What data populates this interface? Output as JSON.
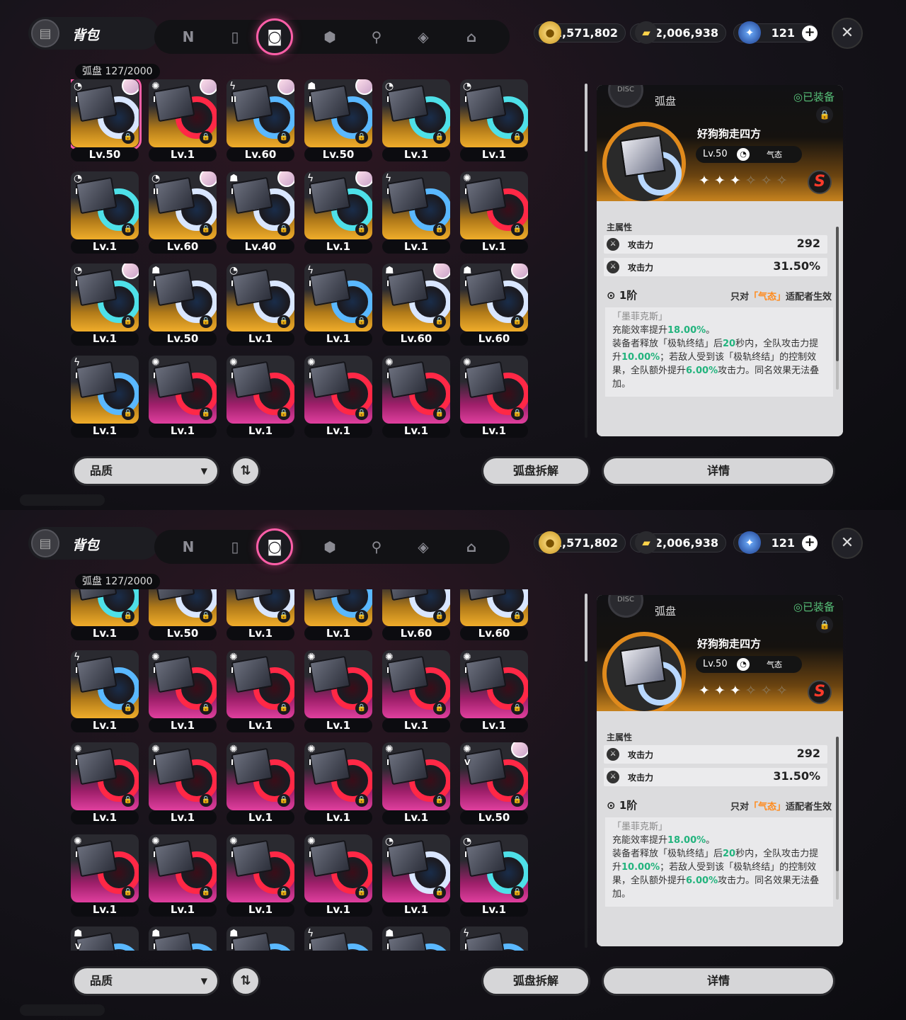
{
  "app": {
    "bag_title": "背包",
    "count_label": "弧盘 127/2000",
    "close": "✕",
    "nav": [
      {
        "icon": "tab-n-icon",
        "glyph": "N"
      },
      {
        "icon": "gameboy-icon",
        "glyph": "▯"
      },
      {
        "icon": "disc-tab-icon",
        "glyph": "◙",
        "active": true
      },
      {
        "icon": "box-icon",
        "glyph": "⬢"
      },
      {
        "icon": "food-icon",
        "glyph": "⚲"
      },
      {
        "icon": "cube-icon",
        "glyph": "◈"
      },
      {
        "icon": "home-icon",
        "glyph": "⌂"
      }
    ]
  },
  "currency": {
    "coins": "1,571,802",
    "tickets": "2,006,938",
    "gems": "121"
  },
  "buttons": {
    "quality": "品质",
    "dismantle": "弧盘拆解",
    "details": "详情",
    "sort": "⇅"
  },
  "detail": {
    "type": "弧盘",
    "equipped": "◎已装备",
    "name": "好狗狗走四方",
    "level": "Lv.50",
    "attr": "气态",
    "stars_on": 3,
    "stars_total": 6,
    "rank": "S",
    "main_stats_title": "主属性",
    "stats": [
      {
        "name": "攻击力",
        "value": "292"
      },
      {
        "name": "攻击力",
        "value": "31.50%"
      }
    ],
    "tier": "1阶",
    "tier_note_pre": "只对",
    "tier_note_q": "「气态」",
    "tier_note_post": "适配者生效",
    "passive_title": "「墨菲克斯」",
    "p1a": "充能效率提升",
    "p1b": "18.00%",
    "p1c": "。",
    "p2a": "装备者释放「极轨终结」后",
    "p2b": "20",
    "p2c": "秒内，全队攻击力提升",
    "p2d": "10.00%",
    "p2e": "；若敌人受到该「极轨终结」的控制效果，全队额外提升",
    "p2f": "6.00%",
    "p2g": "攻击力。同名效果无法叠加。"
  },
  "grid1": [
    {
      "lv": "Lv.50",
      "rank": "I",
      "bg": "gold",
      "ring": "white",
      "av": true,
      "sel": true,
      "at": "◔"
    },
    {
      "lv": "Lv.1",
      "rank": "I",
      "bg": "gold",
      "ring": "red",
      "av": true,
      "at": "✺"
    },
    {
      "lv": "Lv.60",
      "rank": "II",
      "bg": "gold",
      "ring": "blue",
      "av": true,
      "at": "ϟ"
    },
    {
      "lv": "Lv.50",
      "rank": "I",
      "bg": "gold",
      "ring": "blue",
      "av": true,
      "at": "☗"
    },
    {
      "lv": "Lv.1",
      "rank": "I",
      "bg": "gold",
      "ring": "teal",
      "av": false,
      "at": "◔"
    },
    {
      "lv": "Lv.1",
      "rank": "I",
      "bg": "gold",
      "ring": "teal",
      "av": false,
      "at": "◔"
    },
    {
      "lv": "Lv.1",
      "rank": "I",
      "bg": "gold",
      "ring": "teal",
      "av": false,
      "at": "◔"
    },
    {
      "lv": "Lv.60",
      "rank": "II",
      "bg": "gold",
      "ring": "white",
      "av": true,
      "at": "◔"
    },
    {
      "lv": "Lv.40",
      "rank": "I",
      "bg": "gold",
      "ring": "white",
      "av": true,
      "at": "☗"
    },
    {
      "lv": "Lv.1",
      "rank": "I",
      "bg": "gold",
      "ring": "teal",
      "av": true,
      "at": "ϟ"
    },
    {
      "lv": "Lv.1",
      "rank": "I",
      "bg": "gold",
      "ring": "blue",
      "av": false,
      "at": "ϟ"
    },
    {
      "lv": "Lv.1",
      "rank": "I",
      "bg": "gold",
      "ring": "red",
      "av": false,
      "at": "✺"
    },
    {
      "lv": "Lv.1",
      "rank": "I",
      "bg": "gold",
      "ring": "teal",
      "av": true,
      "at": "◔"
    },
    {
      "lv": "Lv.50",
      "rank": "I",
      "bg": "gold",
      "ring": "white",
      "av": false,
      "at": "☗"
    },
    {
      "lv": "Lv.1",
      "rank": "I",
      "bg": "gold",
      "ring": "white",
      "av": false,
      "at": "◔"
    },
    {
      "lv": "Lv.1",
      "rank": "I",
      "bg": "gold",
      "ring": "blue",
      "av": false,
      "at": "ϟ"
    },
    {
      "lv": "Lv.60",
      "rank": "I",
      "bg": "gold",
      "ring": "white",
      "av": true,
      "at": "☗"
    },
    {
      "lv": "Lv.60",
      "rank": "I",
      "bg": "gold",
      "ring": "white",
      "av": true,
      "at": "☗"
    },
    {
      "lv": "Lv.1",
      "rank": "I",
      "bg": "gold",
      "ring": "blue",
      "av": false,
      "at": "ϟ"
    },
    {
      "lv": "Lv.1",
      "rank": "I",
      "bg": "pink",
      "ring": "red",
      "av": false,
      "at": "✺"
    },
    {
      "lv": "Lv.1",
      "rank": "I",
      "bg": "pink",
      "ring": "red",
      "av": false,
      "at": "✺"
    },
    {
      "lv": "Lv.1",
      "rank": "I",
      "bg": "pink",
      "ring": "red",
      "av": false,
      "at": "✺"
    },
    {
      "lv": "Lv.1",
      "rank": "I",
      "bg": "pink",
      "ring": "red",
      "av": false,
      "at": "✺"
    },
    {
      "lv": "Lv.1",
      "rank": "I",
      "bg": "pink",
      "ring": "red",
      "av": false,
      "at": "✺"
    }
  ],
  "grid2": [
    {
      "lv": "Lv.1",
      "rank": "",
      "bg": "gold",
      "ring": "teal",
      "av": false,
      "at": ""
    },
    {
      "lv": "Lv.50",
      "rank": "",
      "bg": "gold",
      "ring": "white",
      "av": false,
      "at": ""
    },
    {
      "lv": "Lv.1",
      "rank": "",
      "bg": "gold",
      "ring": "white",
      "av": false,
      "at": ""
    },
    {
      "lv": "Lv.1",
      "rank": "",
      "bg": "gold",
      "ring": "blue",
      "av": false,
      "at": ""
    },
    {
      "lv": "Lv.60",
      "rank": "",
      "bg": "gold",
      "ring": "white",
      "av": false,
      "at": ""
    },
    {
      "lv": "Lv.60",
      "rank": "",
      "bg": "gold",
      "ring": "white",
      "av": false,
      "at": ""
    },
    {
      "lv": "Lv.1",
      "rank": "I",
      "bg": "gold",
      "ring": "blue",
      "av": false,
      "at": "ϟ"
    },
    {
      "lv": "Lv.1",
      "rank": "I",
      "bg": "pink",
      "ring": "red",
      "av": false,
      "at": "✺"
    },
    {
      "lv": "Lv.1",
      "rank": "I",
      "bg": "pink",
      "ring": "red",
      "av": false,
      "at": "✺"
    },
    {
      "lv": "Lv.1",
      "rank": "I",
      "bg": "pink",
      "ring": "red",
      "av": false,
      "at": "✺"
    },
    {
      "lv": "Lv.1",
      "rank": "I",
      "bg": "pink",
      "ring": "red",
      "av": false,
      "at": "✺"
    },
    {
      "lv": "Lv.1",
      "rank": "I",
      "bg": "pink",
      "ring": "red",
      "av": false,
      "at": "✺"
    },
    {
      "lv": "Lv.1",
      "rank": "I",
      "bg": "pink",
      "ring": "red",
      "av": false,
      "at": "✺"
    },
    {
      "lv": "Lv.1",
      "rank": "I",
      "bg": "pink",
      "ring": "red",
      "av": false,
      "at": "✺"
    },
    {
      "lv": "Lv.1",
      "rank": "I",
      "bg": "pink",
      "ring": "red",
      "av": false,
      "at": "✺"
    },
    {
      "lv": "Lv.1",
      "rank": "I",
      "bg": "pink",
      "ring": "red",
      "av": false,
      "at": "✺"
    },
    {
      "lv": "Lv.1",
      "rank": "I",
      "bg": "pink",
      "ring": "red",
      "av": false,
      "at": "✺"
    },
    {
      "lv": "Lv.50",
      "rank": "V",
      "bg": "pink",
      "ring": "red",
      "av": true,
      "at": "✺"
    },
    {
      "lv": "Lv.1",
      "rank": "I",
      "bg": "pink",
      "ring": "red",
      "av": false,
      "at": "✺"
    },
    {
      "lv": "Lv.1",
      "rank": "I",
      "bg": "pink",
      "ring": "red",
      "av": false,
      "at": "✺"
    },
    {
      "lv": "Lv.1",
      "rank": "I",
      "bg": "pink",
      "ring": "red",
      "av": false,
      "at": "✺"
    },
    {
      "lv": "Lv.1",
      "rank": "I",
      "bg": "pink",
      "ring": "red",
      "av": false,
      "at": "✺"
    },
    {
      "lv": "Lv.1",
      "rank": "I",
      "bg": "pink",
      "ring": "white",
      "av": false,
      "at": "◔"
    },
    {
      "lv": "Lv.1",
      "rank": "I",
      "bg": "pink",
      "ring": "teal",
      "av": false,
      "at": "◔"
    },
    {
      "lv": "",
      "rank": "V",
      "bg": "gold",
      "ring": "blue",
      "av": false,
      "at": "☗"
    },
    {
      "lv": "",
      "rank": "I",
      "bg": "gold",
      "ring": "blue",
      "av": false,
      "at": "☗"
    },
    {
      "lv": "",
      "rank": "I",
      "bg": "gold",
      "ring": "blue",
      "av": false,
      "at": "☗"
    },
    {
      "lv": "",
      "rank": "I",
      "bg": "gold",
      "ring": "blue",
      "av": false,
      "at": "ϟ"
    },
    {
      "lv": "",
      "rank": "I",
      "bg": "gold",
      "ring": "blue",
      "av": false,
      "at": "☗"
    },
    {
      "lv": "",
      "rank": "I",
      "bg": "gold",
      "ring": "blue",
      "av": false,
      "at": "ϟ"
    }
  ]
}
